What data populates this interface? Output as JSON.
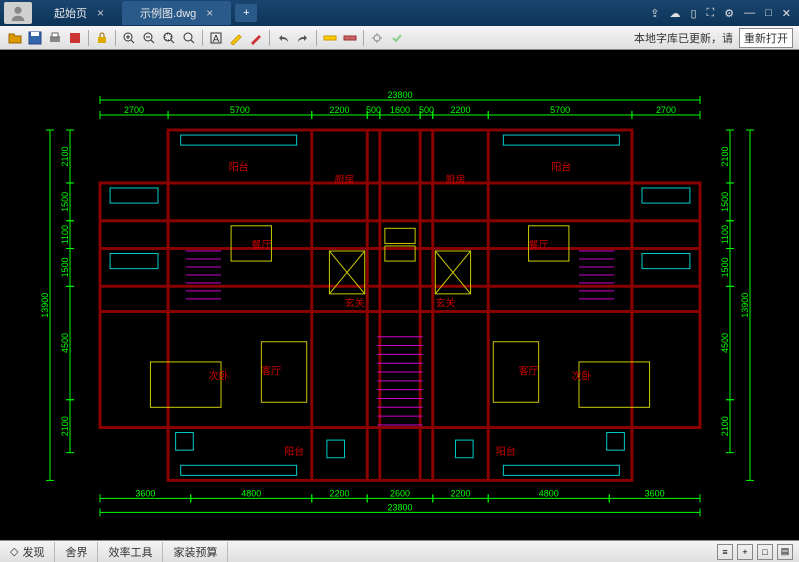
{
  "tabs": {
    "t1": "起始页",
    "t2": "示例图.dwg"
  },
  "title_icons": [
    "share",
    "wechat",
    "mobile",
    "fullscreen",
    "settings",
    "min",
    "max",
    "close"
  ],
  "toolbar_msg": "本地字库已更新，请",
  "reopen": "重新打开",
  "status": {
    "t1": "发现",
    "t2": "舍界",
    "t3": "效率工具",
    "t4": "家装预算"
  },
  "rooms": {
    "yangtai": "阳台",
    "chufang": "厨房",
    "canting": "餐厅",
    "xuanguan": "玄关",
    "cizhi": "次卧",
    "keting": "客厅"
  },
  "dims_top": {
    "total": "23800",
    "d1": "2700",
    "d2": "5700",
    "d3": "2200",
    "d4": "500",
    "d5": "1600",
    "d6": "500",
    "d7": "2200",
    "d8": "5700",
    "d9": "2700"
  },
  "dims_bot": {
    "total": "23800",
    "d1": "3600",
    "d2": "4800",
    "d3": "2200",
    "d4": "2600",
    "d5": "2200",
    "d6": "4800",
    "d7": "3600"
  },
  "dims_left": {
    "total": "13900",
    "d1": "2100",
    "d2": "1500",
    "d3": "1100",
    "d4": "1500",
    "d5": "4500",
    "d6": "2100"
  },
  "dims_right": {
    "total": "13900",
    "d1": "2100",
    "d2": "1500",
    "d3": "1100",
    "d4": "1500",
    "d5": "4500",
    "d6": "2100"
  }
}
